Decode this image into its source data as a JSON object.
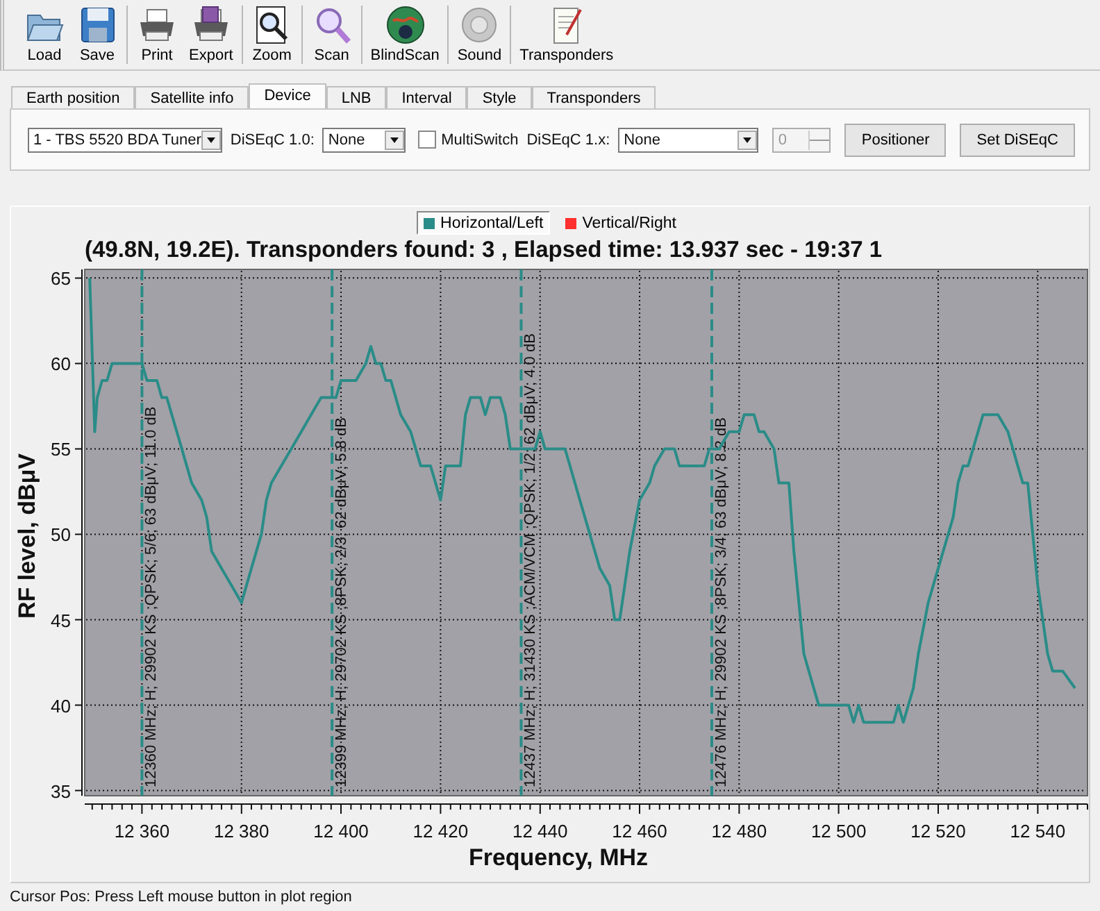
{
  "toolbar": [
    {
      "label": "Load"
    },
    {
      "label": "Save"
    },
    {
      "label": "Print"
    },
    {
      "label": "Export"
    },
    {
      "label": "Zoom"
    },
    {
      "label": "Scan"
    },
    {
      "label": "BlindScan"
    },
    {
      "label": "Sound"
    },
    {
      "label": "Transponders"
    }
  ],
  "tabs": [
    {
      "label": "Earth position",
      "selected": false
    },
    {
      "label": "Satellite info",
      "selected": false
    },
    {
      "label": "Device",
      "selected": true
    },
    {
      "label": "LNB",
      "selected": false
    },
    {
      "label": "Interval",
      "selected": false
    },
    {
      "label": "Style",
      "selected": false
    },
    {
      "label": "Transponders",
      "selected": false
    }
  ],
  "device": {
    "tuner": "1 - TBS 5520 BDA Tuner",
    "diseqc10_label": "DiSEqC 1.0:",
    "diseqc10": "None",
    "multiswitch": {
      "label": "MultiSwitch",
      "checked": false
    },
    "diseqc1x_label": "DiSEqC 1.x:",
    "diseqc1x": "None",
    "spinner": {
      "value": "0",
      "disabled": true
    },
    "buttons": [
      "Positioner",
      "Set DiSEqC"
    ]
  },
  "plot": {
    "legend": [
      {
        "label": "Horizontal/Left",
        "color": "#2a8c88",
        "selected": true
      },
      {
        "label": "Vertical/Right",
        "color": "#ff3030",
        "selected": false
      }
    ],
    "chart_data": {
      "type": "line",
      "title": "(49.8N, 19.2E). Transponders found: 3 , Elapsed time: 13.937 sec - 19:37 1",
      "xlabel": "Frequency, MHz",
      "ylabel": "RF level, dBμV",
      "xlim": [
        12348.5,
        12550
      ],
      "ylim": [
        34.7,
        65.5
      ],
      "xticks": [
        {
          "value": 12360,
          "label": "12 360"
        },
        {
          "value": 12380,
          "label": "12 380"
        },
        {
          "value": 12400,
          "label": "12 400"
        },
        {
          "value": 12420,
          "label": "12 420"
        },
        {
          "value": 12440,
          "label": "12 440"
        },
        {
          "value": 12460,
          "label": "12 460"
        },
        {
          "value": 12480,
          "label": "12 480"
        },
        {
          "value": 12500,
          "label": "12 500"
        },
        {
          "value": 12520,
          "label": "12 520"
        },
        {
          "value": 12540,
          "label": "12 540"
        }
      ],
      "yticks": [
        35,
        40,
        45,
        50,
        55,
        60,
        65
      ],
      "x": [
        12349.5,
        12350.5,
        12351,
        12352,
        12353,
        12354,
        12358,
        12360,
        12361,
        12363,
        12364,
        12365,
        12366,
        12367,
        12368,
        12370,
        12372,
        12373,
        12374,
        12376,
        12378,
        12380,
        12382,
        12384,
        12385,
        12386,
        12388,
        12390,
        12392,
        12394,
        12396,
        12398,
        12399,
        12400,
        12403,
        12405,
        12406,
        12407,
        12408,
        12409,
        12410,
        12412,
        12414,
        12415,
        12416,
        12418,
        12419,
        12420,
        12421,
        12424,
        12425,
        12426,
        12428,
        12429,
        12430,
        12432,
        12433,
        12434,
        12437,
        12439,
        12440,
        12441,
        12445,
        12446,
        12448,
        12450,
        12452,
        12454,
        12455,
        12456,
        12457,
        12458,
        12460,
        12462,
        12463,
        12465,
        12467,
        12468,
        12473,
        12474,
        12476,
        12478,
        12480,
        12481,
        12483,
        12484,
        12485,
        12487,
        12488,
        12490,
        12491,
        12492,
        12493,
        12495,
        12496,
        12502,
        12503,
        12504,
        12505,
        12511,
        12512,
        12513,
        12515,
        12516,
        12518,
        12520,
        12521,
        12522,
        12523,
        12524,
        12525,
        12526,
        12527,
        12528,
        12529,
        12532,
        12534,
        12535,
        12536,
        12537,
        12538,
        12539,
        12540,
        12541,
        12542,
        12543,
        12545,
        12547.5
      ],
      "series": [
        {
          "color": "#2a8c88",
          "values": [
            65,
            56,
            58,
            59,
            59,
            60,
            60,
            60,
            59,
            59,
            58,
            58,
            57,
            56,
            55,
            53,
            52,
            51,
            49,
            48,
            47,
            46,
            48,
            50,
            52,
            53,
            54,
            55,
            56,
            57,
            58,
            58,
            58,
            59,
            59,
            60,
            61,
            60,
            60,
            59,
            59,
            57,
            56,
            55,
            54,
            54,
            53,
            52,
            54,
            54,
            57,
            58,
            58,
            57,
            58,
            58,
            57,
            55,
            55,
            55,
            56,
            55,
            55,
            54,
            52,
            50,
            48,
            47,
            45,
            45,
            47,
            49,
            52,
            53,
            54,
            55,
            55,
            54,
            54,
            55,
            55,
            56,
            56,
            57,
            57,
            56,
            56,
            55,
            53,
            53,
            49,
            46,
            43,
            41,
            40,
            40,
            39,
            40,
            39,
            39,
            40,
            39,
            41,
            43,
            46,
            48,
            49,
            50,
            51,
            53,
            54,
            54,
            55,
            56,
            57,
            57,
            56,
            55,
            54,
            53,
            53,
            50,
            47,
            45,
            43,
            42,
            42,
            41
          ]
        }
      ],
      "grid": true,
      "ref_lines": [
        {
          "axis": "x",
          "value": 12360,
          "color": "#2a8c88",
          "label": "12360 MHz; H; 29902 KS ;QPSK; 5/6; 63 dBμV; 11.0 dB"
        },
        {
          "axis": "x",
          "value": 12398.2,
          "color": "#2a8c88",
          "label": "12399 MHz; H; 29702 KS ;8PSK; 2/3; 62 dBμV; 5.8 dB"
        },
        {
          "axis": "x",
          "value": 12436.2,
          "color": "#2a8c88",
          "label": "12437 MHz; H; 31430 KS ;ACM/VCM ;QPSK; 1/2; 62 dBμV; 4.0 dB"
        },
        {
          "axis": "x",
          "value": 12474.5,
          "color": "#2a8c88",
          "label": "12476 MHz; H; 29902 KS ;8PSK; 3/4; 63 dBμV; 8.2 dB"
        }
      ]
    }
  },
  "status_bar": "Cursor Pos: Press Left mouse button in plot region"
}
